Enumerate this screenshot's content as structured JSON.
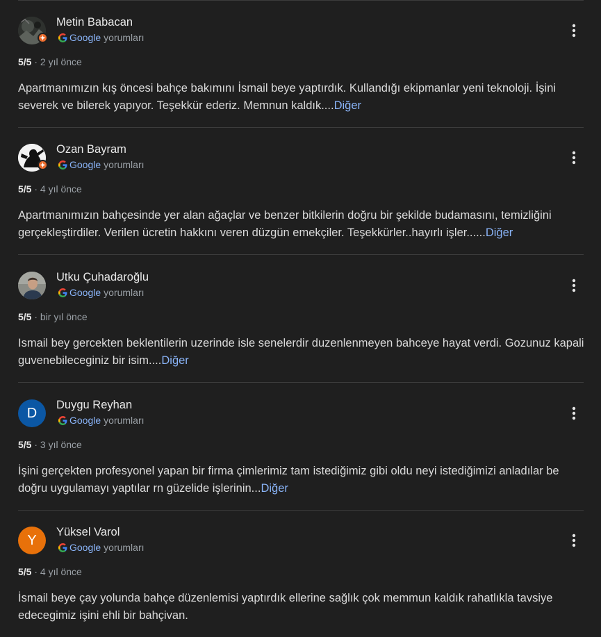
{
  "reviews": [
    {
      "author": "Metin Babacan",
      "google": "Google",
      "source_suffix": "yorumları",
      "avatar": {
        "type": "photo",
        "icon": "dark-photo-avatar-icon",
        "bg": "#3a3d3a"
      },
      "local_guide": true,
      "rating": "5/5",
      "time": " · 2 yıl önce",
      "text": "Apartmanımızın kış öncesi bahçe bakımını İsmail beye yaptırdık. Kullandığı ekipmanlar yeni teknoloji. İşini severek ve bilerek yapıyor. Teşekkür ederiz. Memnun kaldık....",
      "more": "Diğer"
    },
    {
      "author": "Ozan Bayram",
      "google": "Google",
      "source_suffix": "yorumları",
      "avatar": {
        "type": "photo",
        "icon": "silhouette-photo-avatar-icon",
        "bg": "#ffffff"
      },
      "local_guide": true,
      "rating": "5/5",
      "time": " · 4 yıl önce",
      "text": "Apartmanımızın bahçesinde yer alan ağaçlar ve benzer bitkilerin doğru bir şekilde budamasını, temizliğini gerçekleştirdiler. Verilen ücretin hakkını veren düzgün emekçiler. Teşekkürler..hayırlı işler......",
      "more": "Diğer"
    },
    {
      "author": "Utku Çuhadaroğlu",
      "google": "Google",
      "source_suffix": "yorumları",
      "avatar": {
        "type": "photo",
        "icon": "portrait-photo-avatar-icon",
        "bg": "#6b6e6a"
      },
      "local_guide": false,
      "rating": "5/5",
      "time": " · bir yıl önce",
      "text": "Ismail bey gercekten beklentilerin uzerinde isle senelerdir duzenlenmeyen bahceye hayat verdi. Gozunuz kapali guvenebileceginiz bir isim....",
      "more": "Diğer"
    },
    {
      "author": "Duygu Reyhan",
      "google": "Google",
      "source_suffix": "yorumları",
      "avatar": {
        "type": "letter",
        "letter": "D",
        "bg": "#0b57a4"
      },
      "local_guide": false,
      "rating": "5/5",
      "time": " · 3 yıl önce",
      "text": "İşini gerçekten profesyonel yapan bir firma çimlerimiz tam istediğimiz gibi oldu neyi istediğimizi anladılar be doğru uygulamayı yaptılar rn güzelide işlerinin...",
      "more": "Diğer"
    },
    {
      "author": "Yüksel Varol",
      "google": "Google",
      "source_suffix": "yorumları",
      "avatar": {
        "type": "letter",
        "letter": "Y",
        "bg": "#e8710a"
      },
      "local_guide": false,
      "rating": "5/5",
      "time": " · 4 yıl önce",
      "text": "İsmail beye çay yolunda bahçe düzenlemisi yaptırdık ellerine sağlık çok memmun kaldık rahatlıkla tavsiye edecegimiz işini ehli bir bahçivan.",
      "more": ""
    }
  ],
  "colors": {
    "background": "#1f1f1f",
    "link": "#8ab4f8",
    "badge": "#ea6b2c",
    "divider": "#3c3c3c"
  }
}
